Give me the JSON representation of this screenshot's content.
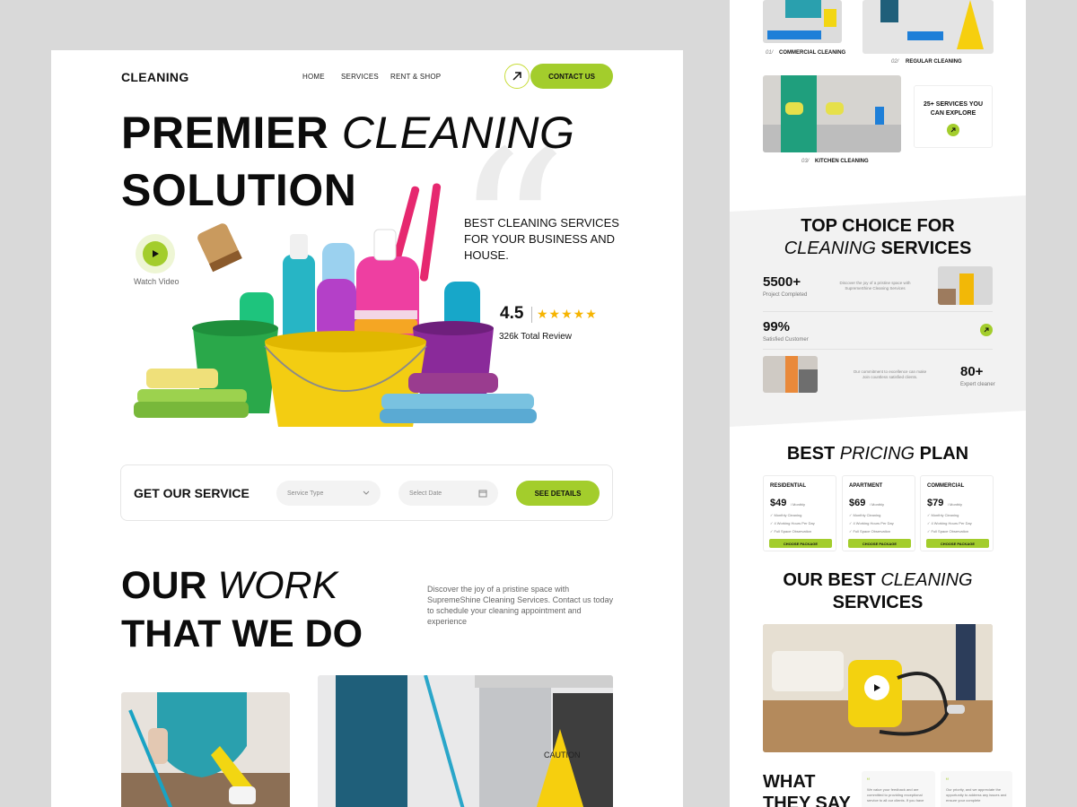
{
  "colors": {
    "accent": "#a3cd2c",
    "star": "#f6b400",
    "background": "#d9d9d9"
  },
  "header": {
    "brand": "CLEANING",
    "nav": [
      "HOME",
      "SERVICES",
      "RENT & SHOP"
    ],
    "arrow_icon": "arrow-up-right-icon",
    "contact_label": "CONTACT US"
  },
  "hero": {
    "title_line1_bold": "PREMIER",
    "title_line1_italic": "CLEANING",
    "title_line2": "SOLUTION",
    "tagline": "BEST CLEANING SERVICES FOR YOUR BUSINESS AND HOUSE.",
    "rating": "4.5",
    "stars": "★★★★★",
    "reviews": "326k Total Review",
    "watch_label": "Watch Video",
    "play_icon": "play-icon"
  },
  "service_bar": {
    "title": "GET OUR SERVICE",
    "service_type_placeholder": "Service Type",
    "date_placeholder": "Select Date",
    "cta": "SEE DETAILS"
  },
  "work": {
    "title_bold": "OUR",
    "title_italic": "WORK",
    "title_line2": "THAT WE DO",
    "description": "Discover the joy of a pristine space with SupremeShine Cleaning Services. Contact us today to schedule your cleaning appointment and experience"
  },
  "gallery": {
    "items": [
      {
        "num": "01/",
        "label": "COMMERCIAL CLEANING"
      },
      {
        "num": "02/",
        "label": "REGULAR CLEANING"
      },
      {
        "num": "03/",
        "label": "KITCHEN CLEANING"
      }
    ],
    "explore_text": "25+ SERVICES YOU CAN EXPLORE"
  },
  "top_choice": {
    "title_line1": "TOP CHOICE FOR",
    "title_italic": "CLEANING",
    "title_bold": "SERVICES",
    "stats": [
      {
        "value": "5500+",
        "label": "Project Completed"
      },
      {
        "value": "99%",
        "label": "Satisfied Customer"
      },
      {
        "value": "80+",
        "label": "Expert cleaner"
      }
    ],
    "blurb1": "Discover the joy of a pristine space with SupremeShine Cleaning Services",
    "blurb2": "Our commitment to excellence can make Join countless satisfied clients."
  },
  "pricing": {
    "title_bold": "BEST",
    "title_italic": "PRICING",
    "title_end": "PLAN",
    "plans": [
      {
        "name": "RESIDENTIAL",
        "price": "$49",
        "period": "/ Monthly",
        "features": [
          "Monthly Cleaning",
          "4 Working Hours Per Day",
          "Full Space Observation"
        ],
        "cta": "CHOOSE PACKAGE"
      },
      {
        "name": "APARTMENT",
        "price": "$69",
        "period": "/ Monthly",
        "features": [
          "Monthly Cleaning",
          "4 Working Hours Per Day",
          "Full Space Observation"
        ],
        "cta": "CHOOSE PACKAGE"
      },
      {
        "name": "COMMERCIAL",
        "price": "$79",
        "period": "/ Monthly",
        "features": [
          "Monthly Cleaning",
          "4 Working Hours Per Day",
          "Full Space Observation"
        ],
        "cta": "CHOOSE PACKAGE"
      }
    ]
  },
  "best_services": {
    "title_bold": "OUR BEST",
    "title_italic": "CLEANING",
    "title_line2": "SERVICES"
  },
  "testimonials": {
    "title_line1": "WHAT",
    "title_line2": "THEY SAY",
    "quotes": [
      "We value your feedback and are committed to providing exceptional service to all our clients. If you have",
      "Our priority, and we appreciate the opportunity to address any issues and ensure your complete"
    ]
  }
}
